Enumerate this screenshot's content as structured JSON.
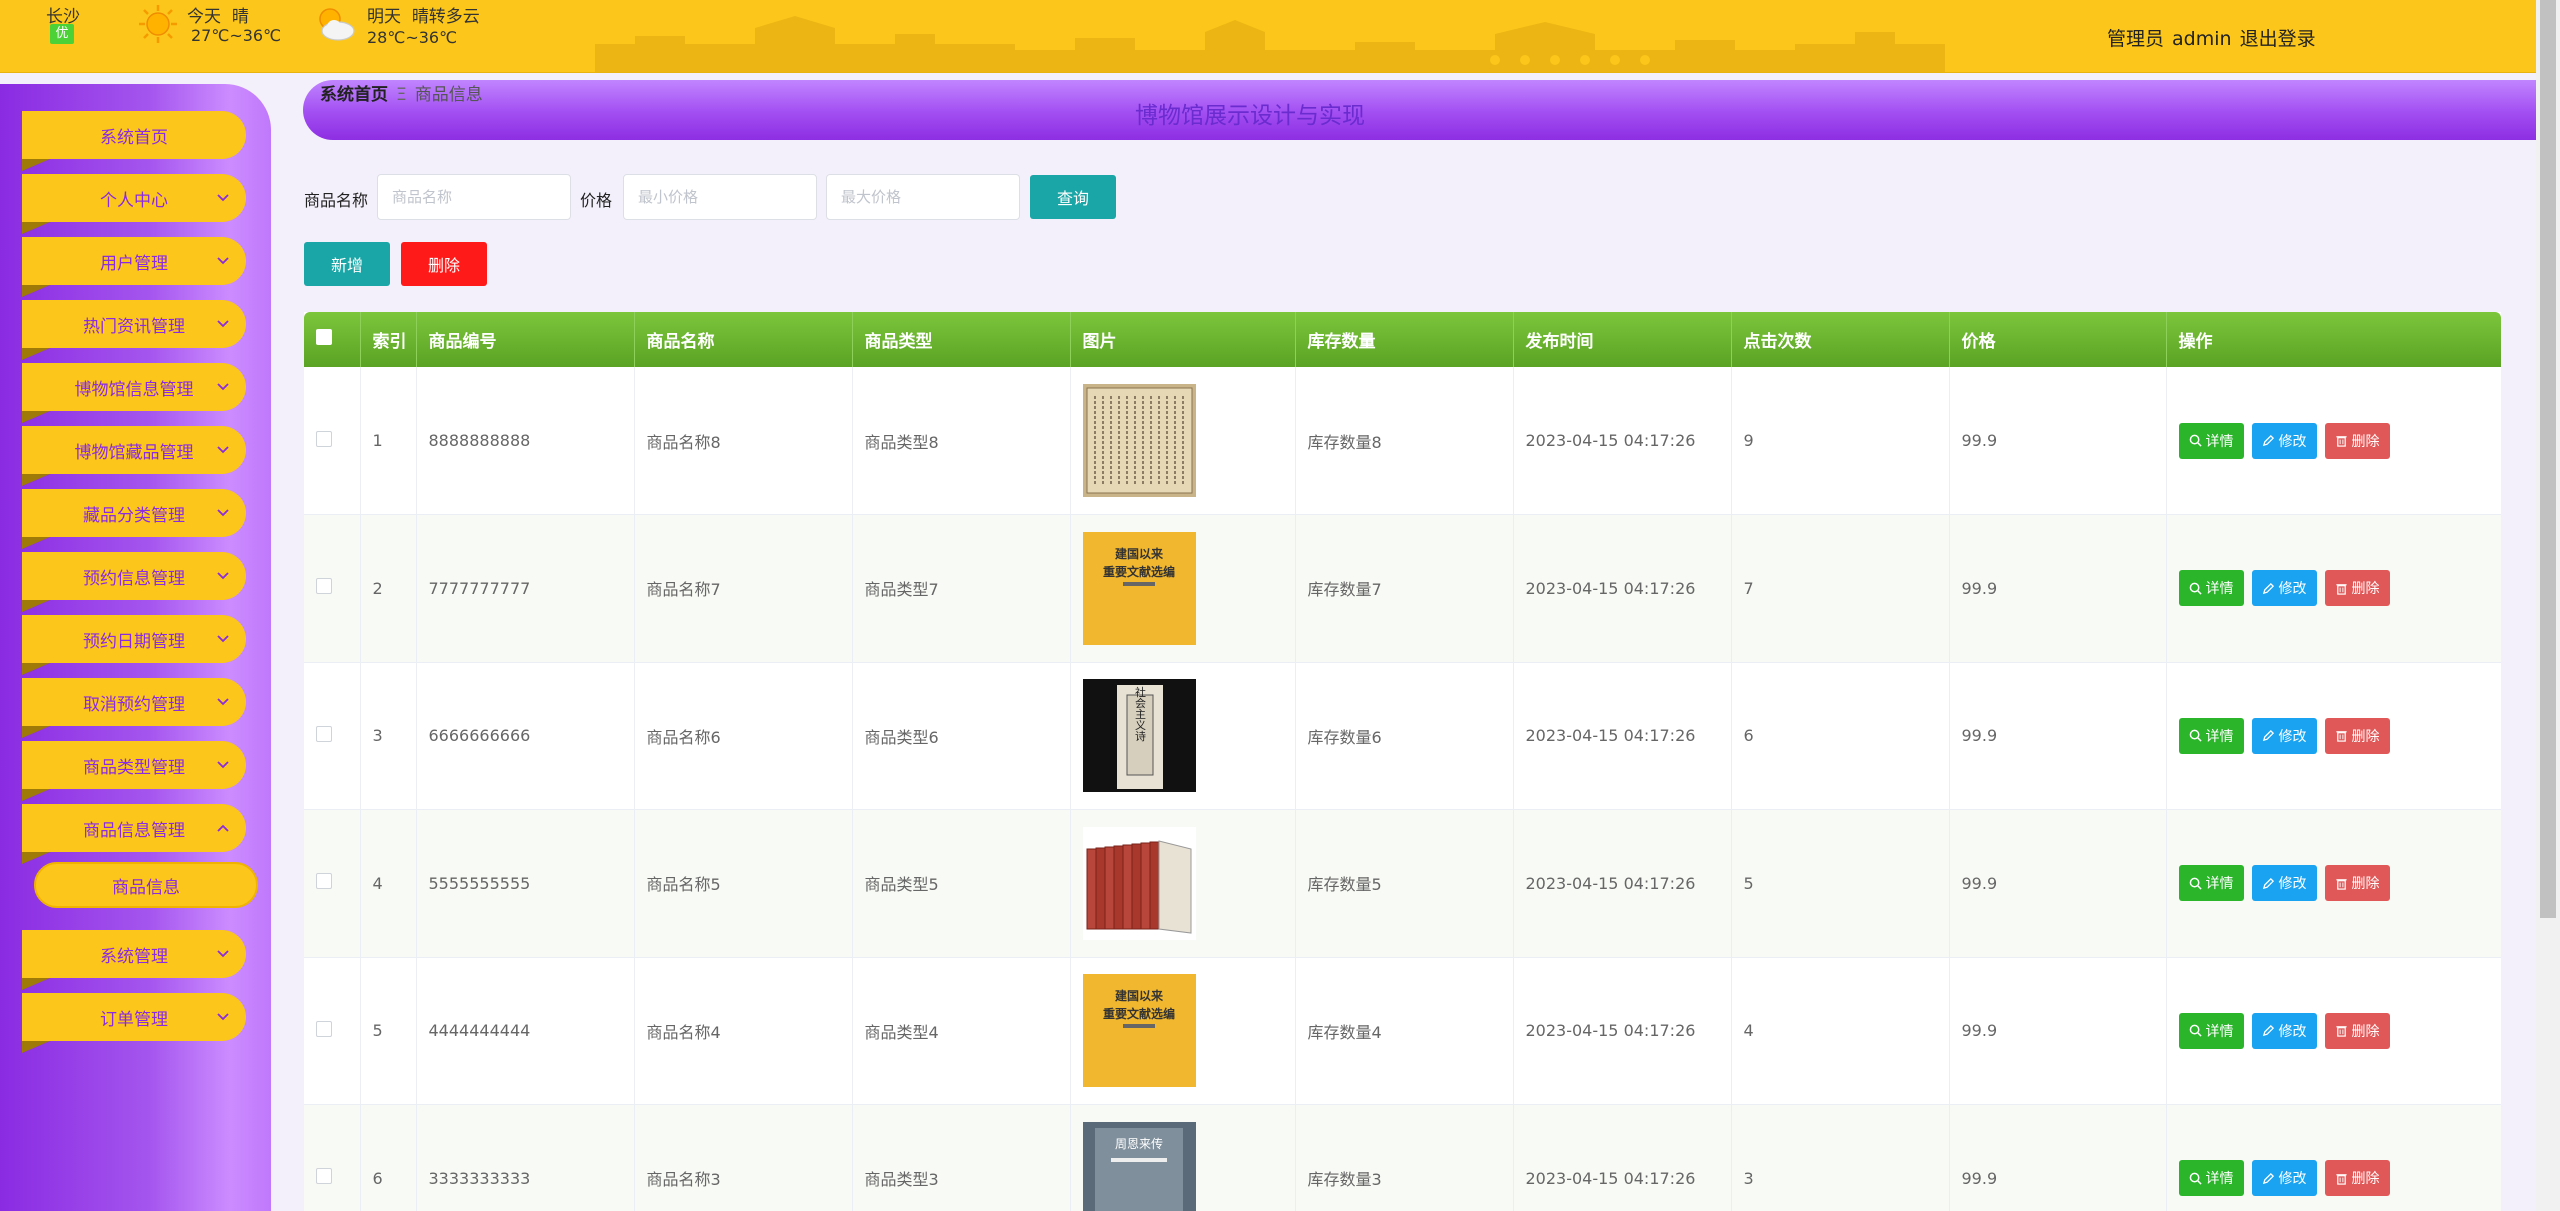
{
  "weather": {
    "city": "长沙",
    "aqi": "优",
    "today_label": "今天",
    "today_cond": "晴",
    "today_temp": "27℃~36℃",
    "tomorrow_label": "明天",
    "tomorrow_cond": "晴转多云",
    "tomorrow_temp": "28℃~36℃"
  },
  "user": {
    "role": "管理员",
    "name": "admin",
    "logout": "退出登录"
  },
  "sidebar": {
    "items": [
      {
        "label": "系统首页"
      },
      {
        "label": "个人中心"
      },
      {
        "label": "用户管理"
      },
      {
        "label": "热门资讯管理"
      },
      {
        "label": "博物馆信息管理"
      },
      {
        "label": "博物馆藏品管理"
      },
      {
        "label": "藏品分类管理"
      },
      {
        "label": "预约信息管理"
      },
      {
        "label": "预约日期管理"
      },
      {
        "label": "取消预约管理"
      },
      {
        "label": "商品类型管理"
      },
      {
        "label": "商品信息管理"
      },
      {
        "label": "系统管理"
      },
      {
        "label": "订单管理"
      }
    ],
    "sub_item": "商品信息"
  },
  "breadcrumb": {
    "home": "系统首页",
    "sep": "Ξ",
    "current": "商品信息"
  },
  "site_title": "博物馆展示设计与实现",
  "search": {
    "name_label": "商品名称",
    "name_placeholder": "商品名称",
    "price_label": "价格",
    "min_placeholder": "最小价格",
    "max_placeholder": "最大价格",
    "query": "查询"
  },
  "actions": {
    "add": "新增",
    "delete": "删除"
  },
  "table": {
    "headers": [
      "索引",
      "商品编号",
      "商品名称",
      "商品类型",
      "图片",
      "库存数量",
      "发布时间",
      "点击次数",
      "价格",
      "操作"
    ],
    "op_detail": "详情",
    "op_edit": "修改",
    "op_delete": "删除",
    "rows": [
      {
        "idx": "1",
        "code": "8888888888",
        "name": "商品名称8",
        "type": "商品类型8",
        "stock": "库存数量8",
        "time": "2023-04-15 04:17:26",
        "clicks": "9",
        "price": "99.9",
        "img": "ancient-book"
      },
      {
        "idx": "2",
        "code": "7777777777",
        "name": "商品名称7",
        "type": "商品类型7",
        "stock": "库存数量7",
        "time": "2023-04-15 04:17:26",
        "clicks": "7",
        "price": "99.9",
        "img": "yellow-book"
      },
      {
        "idx": "3",
        "code": "6666666666",
        "name": "商品名称6",
        "type": "商品类型6",
        "stock": "库存数量6",
        "time": "2023-04-15 04:17:26",
        "clicks": "6",
        "price": "99.9",
        "img": "dark-book"
      },
      {
        "idx": "4",
        "code": "5555555555",
        "name": "商品名称5",
        "type": "商品类型5",
        "stock": "库存数量5",
        "time": "2023-04-15 04:17:26",
        "clicks": "5",
        "price": "99.9",
        "img": "book-set"
      },
      {
        "idx": "5",
        "code": "4444444444",
        "name": "商品名称4",
        "type": "商品类型4",
        "stock": "库存数量4",
        "time": "2023-04-15 04:17:26",
        "clicks": "4",
        "price": "99.9",
        "img": "yellow-book"
      },
      {
        "idx": "6",
        "code": "3333333333",
        "name": "商品名称3",
        "type": "商品类型3",
        "stock": "库存数量3",
        "time": "2023-04-15 04:17:26",
        "clicks": "3",
        "price": "99.9",
        "img": "blue-book"
      }
    ]
  },
  "book_covers": {
    "cover_text_a": "建国以来",
    "cover_text_b": "重要文献选编",
    "dark_text": "社会主义诗",
    "blue_text": "周恩来传"
  }
}
